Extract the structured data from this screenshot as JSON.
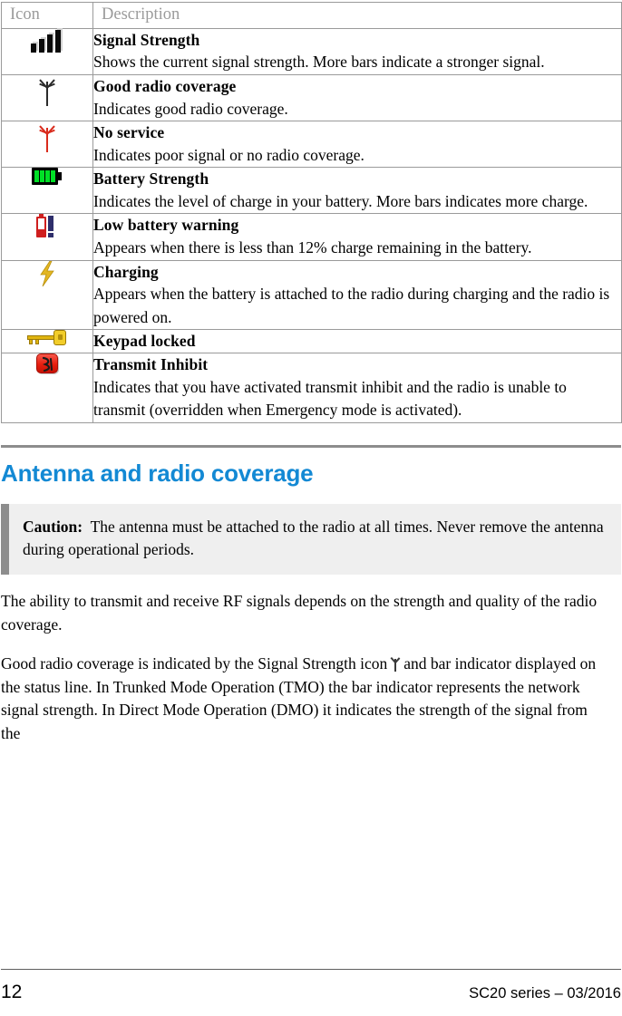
{
  "table": {
    "headers": [
      "Icon",
      "Description"
    ],
    "rows": [
      {
        "icon": "signal-bars-icon",
        "title": "Signal Strength",
        "body": "Shows the current signal strength. More bars indicate a stronger signal."
      },
      {
        "icon": "antenna-dark-icon",
        "title": "Good radio coverage",
        "body": "Indicates good radio coverage."
      },
      {
        "icon": "antenna-red-icon",
        "title": "No service",
        "body": "Indicates poor signal or no radio coverage."
      },
      {
        "icon": "battery-full-icon",
        "title": "Battery Strength",
        "body": "Indicates the level of charge in your battery. More bars indicates more charge."
      },
      {
        "icon": "low-battery-icon",
        "title": "Low battery warning",
        "body": "Appears when there is less than 12% charge remaining in the battery."
      },
      {
        "icon": "lightning-bolt-icon",
        "title": "Charging",
        "body": "Appears when the battery is attached to the radio during charging and the radio is powered on."
      },
      {
        "icon": "key-icon",
        "title": "Keypad locked",
        "body": ""
      },
      {
        "icon": "transmit-inhibit-icon",
        "title": "Transmit Inhibit",
        "body": "Indicates that you have activated transmit inhibit and the radio is unable to transmit (overridden when Emergency mode is activated)."
      }
    ]
  },
  "section": {
    "heading": "Antenna and radio coverage"
  },
  "caution": {
    "label": "Caution:",
    "text": "The antenna must be attached to the radio at all times. Never remove the antenna during operational periods."
  },
  "paragraphs": {
    "p1": "The ability to transmit and receive RF signals depends on the strength and quality of the radio coverage.",
    "p2_before_icon": "Good radio coverage is indicated by the Signal Strength icon",
    "p2_after_icon": "and bar indicator displayed on the status line. In Trunked Mode Operation (TMO) the bar indicator represents the network signal strength. In Direct Mode Operation (DMO) it indicates the strength of the signal from the"
  },
  "footer": {
    "page_number": "12",
    "series": "SC20 series – 03/2016"
  },
  "colors": {
    "heading_blue": "#1389d4",
    "header_gray": "#9b9b9b",
    "rule_gray": "#8d8d8d",
    "caution_bg": "#efefef",
    "battery_green": "#00e026",
    "alert_red": "#d92b1c",
    "key_gold": "#f2cd2a"
  }
}
